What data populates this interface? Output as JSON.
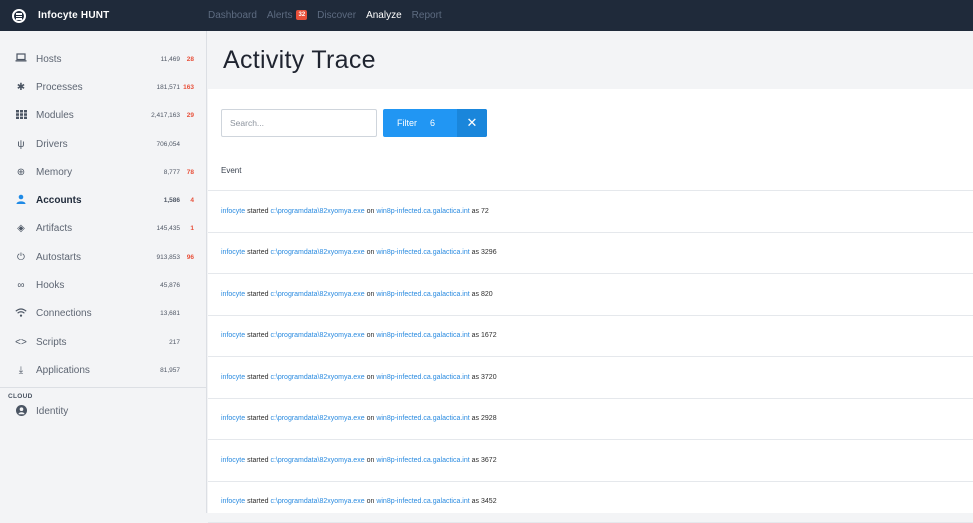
{
  "app": {
    "brand": "Infocyte HUNT",
    "nav": [
      {
        "label": "Dashboard",
        "active": false
      },
      {
        "label": "Alerts",
        "active": false,
        "badge": "32"
      },
      {
        "label": "Discover",
        "active": false
      },
      {
        "label": "Analyze",
        "active": true
      },
      {
        "label": "Report",
        "active": false
      }
    ]
  },
  "sidebar": {
    "items": [
      {
        "label": "Hosts",
        "count": "11,469",
        "alerts": "28",
        "icon": "laptop-icon"
      },
      {
        "label": "Processes",
        "count": "181,571",
        "alerts": "163",
        "icon": "cog-icon"
      },
      {
        "label": "Modules",
        "count": "2,417,163",
        "alerts": "29",
        "icon": "grid-icon"
      },
      {
        "label": "Drivers",
        "count": "706,054",
        "alerts": "",
        "icon": "usb-icon"
      },
      {
        "label": "Memory",
        "count": "8,777",
        "alerts": "78",
        "icon": "memory-icon"
      },
      {
        "label": "Accounts",
        "count": "1,586",
        "alerts": "4",
        "icon": "user-icon",
        "active": true
      },
      {
        "label": "Artifacts",
        "count": "145,435",
        "alerts": "1",
        "icon": "layers-icon"
      },
      {
        "label": "Autostarts",
        "count": "913,853",
        "alerts": "96",
        "icon": "power-icon"
      },
      {
        "label": "Hooks",
        "count": "45,876",
        "alerts": "",
        "icon": "link-icon"
      },
      {
        "label": "Connections",
        "count": "13,681",
        "alerts": "",
        "icon": "wifi-icon"
      },
      {
        "label": "Scripts",
        "count": "217",
        "alerts": "",
        "icon": "code-icon"
      },
      {
        "label": "Applications",
        "count": "81,957",
        "alerts": "",
        "icon": "download-icon"
      }
    ],
    "cloud_label": "CLOUD",
    "identity": {
      "label": "Identity",
      "icon": "user-circle-icon"
    }
  },
  "main": {
    "title": "Activity Trace",
    "search_placeholder": "Search...",
    "filter": {
      "label": "Filter",
      "count": "6",
      "clear_icon": "close-icon"
    },
    "column_header": "Event",
    "rows": [
      {
        "user": "infocyte",
        "verb": "started",
        "path": "c:\\programdata\\82xyomya.exe",
        "on": "on",
        "host": "win8p-infected.ca.galactica.int",
        "as": "as",
        "pid": "72"
      },
      {
        "user": "infocyte",
        "verb": "started",
        "path": "c:\\programdata\\82xyomya.exe",
        "on": "on",
        "host": "win8p-infected.ca.galactica.int",
        "as": "as",
        "pid": "3296"
      },
      {
        "user": "infocyte",
        "verb": "started",
        "path": "c:\\programdata\\82xyomya.exe",
        "on": "on",
        "host": "win8p-infected.ca.galactica.int",
        "as": "as",
        "pid": "820"
      },
      {
        "user": "infocyte",
        "verb": "started",
        "path": "c:\\programdata\\82xyomya.exe",
        "on": "on",
        "host": "win8p-infected.ca.galactica.int",
        "as": "as",
        "pid": "1672"
      },
      {
        "user": "infocyte",
        "verb": "started",
        "path": "c:\\programdata\\82xyomya.exe",
        "on": "on",
        "host": "win8p-infected.ca.galactica.int",
        "as": "as",
        "pid": "3720"
      },
      {
        "user": "infocyte",
        "verb": "started",
        "path": "c:\\programdata\\82xyomya.exe",
        "on": "on",
        "host": "win8p-infected.ca.galactica.int",
        "as": "as",
        "pid": "2928"
      },
      {
        "user": "infocyte",
        "verb": "started",
        "path": "c:\\programdata\\82xyomya.exe",
        "on": "on",
        "host": "win8p-infected.ca.galactica.int",
        "as": "as",
        "pid": "3672"
      },
      {
        "user": "infocyte",
        "verb": "started",
        "path": "c:\\programdata\\82xyomya.exe",
        "on": "on",
        "host": "win8p-infected.ca.galactica.int",
        "as": "as",
        "pid": "3452"
      }
    ]
  },
  "colors": {
    "topbar": "#1f2a3a",
    "accent": "#2196f3",
    "link": "#2a8be0",
    "alert": "#e8503a"
  }
}
